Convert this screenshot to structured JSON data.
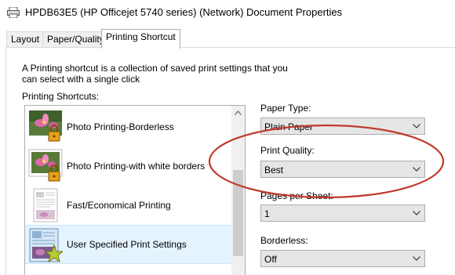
{
  "window": {
    "title": "HPDB63E5 (HP Officejet 5740 series) (Network) Document Properties"
  },
  "tabs": [
    {
      "label": "Layout",
      "active": false
    },
    {
      "label": "Paper/Quality",
      "active": false
    },
    {
      "label": "Printing Shortcut",
      "active": true
    }
  ],
  "panel": {
    "description": "A Printing shortcut is a collection of saved print settings that you can select with a single click",
    "shortcuts_label": "Printing Shortcuts:",
    "shortcuts": [
      {
        "label": "Photo Printing-Borderless",
        "icon": "photo-lock-icon",
        "selected": false
      },
      {
        "label": "Photo Printing-with white borders",
        "icon": "photo-lock-icon",
        "selected": false
      },
      {
        "label": "Fast/Economical Printing",
        "icon": "document-icon",
        "selected": false
      },
      {
        "label": "User Specified Print Settings",
        "icon": "user-settings-star-icon",
        "selected": true
      }
    ]
  },
  "settings": {
    "paper_type": {
      "label": "Paper Type:",
      "value": "Plain Paper"
    },
    "print_quality": {
      "label": "Print Quality:",
      "value": "Best"
    },
    "pages_per_sheet": {
      "label": "Pages per Sheet:",
      "value": "1"
    },
    "borderless": {
      "label": "Borderless:",
      "value": "Off"
    }
  },
  "colors": {
    "annotation_circle": "#c0392b",
    "selection": "#e5f3ff",
    "dropdown_bg": "#e5e5e5"
  }
}
